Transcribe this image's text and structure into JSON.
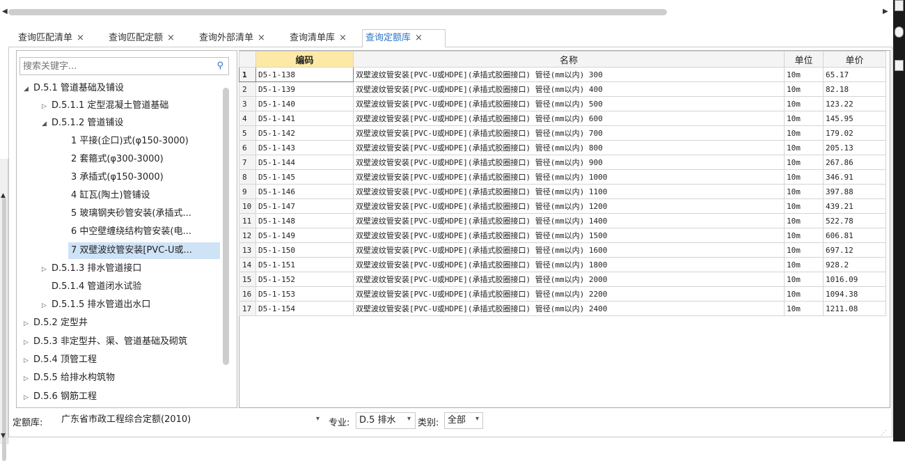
{
  "tabs": [
    {
      "label": "查询匹配清单",
      "close": "×"
    },
    {
      "label": "查询匹配定额",
      "close": "×"
    },
    {
      "label": "查询外部清单",
      "close": "×"
    },
    {
      "label": "查询清单库",
      "close": "×"
    },
    {
      "label": "查询定额库",
      "close": "×",
      "active": true
    }
  ],
  "search": {
    "placeholder": "搜索关键字...",
    "icon": "search-icon"
  },
  "tree": [
    {
      "label": "D.5.1 管道基础及铺设",
      "toggle": "◢"
    },
    {
      "label": "D.5.1.1 定型混凝土管道基础",
      "toggle": "▷"
    },
    {
      "label": "D.5.1.2 管道铺设",
      "toggle": "◢"
    },
    {
      "label": "1 平接(企口)式(φ150-3000)",
      "toggle": ""
    },
    {
      "label": "2 套箍式(φ300-3000)",
      "toggle": ""
    },
    {
      "label": "3 承插式(φ150-3000)",
      "toggle": ""
    },
    {
      "label": "4 缸瓦(陶土)管铺设",
      "toggle": ""
    },
    {
      "label": "5 玻璃钢夹砂管安装(承插式...",
      "toggle": ""
    },
    {
      "label": "6 中空壁缠绕结构管安装(电...",
      "toggle": ""
    },
    {
      "label": "7 双壁波纹管安装[PVC-U或...",
      "toggle": "",
      "selected": true
    },
    {
      "label": "D.5.1.3 排水管道接口",
      "toggle": "▷"
    },
    {
      "label": "D.5.1.4 管道闭水试验",
      "toggle": ""
    },
    {
      "label": "D.5.1.5 排水管道出水口",
      "toggle": "▷"
    },
    {
      "label": "D.5.2 定型井",
      "toggle": "▷"
    },
    {
      "label": "D.5.3 非定型井、渠、管道基础及砌筑",
      "toggle": "▷"
    },
    {
      "label": "D.5.4 顶管工程",
      "toggle": "▷"
    },
    {
      "label": "D.5.5 给排水构筑物",
      "toggle": "▷"
    },
    {
      "label": "D.5.6 钢筋工程",
      "toggle": "▷"
    }
  ],
  "grid": {
    "headers": {
      "code": "编码",
      "name": "名称",
      "unit": "单位",
      "price": "单价"
    },
    "rows": [
      {
        "no": "1",
        "code": "D5-1-138",
        "name": "双壁波纹管安装[PVC-U或HDPE](承插式胶圈接口) 管径(mm以内) 300",
        "unit": "10m",
        "price": "65.17"
      },
      {
        "no": "2",
        "code": "D5-1-139",
        "name": "双壁波纹管安装[PVC-U或HDPE](承插式胶圈接口) 管径(mm以内) 400",
        "unit": "10m",
        "price": "82.18"
      },
      {
        "no": "3",
        "code": "D5-1-140",
        "name": "双壁波纹管安装[PVC-U或HDPE](承插式胶圈接口) 管径(mm以内) 500",
        "unit": "10m",
        "price": "123.22"
      },
      {
        "no": "4",
        "code": "D5-1-141",
        "name": "双壁波纹管安装[PVC-U或HDPE](承插式胶圈接口) 管径(mm以内) 600",
        "unit": "10m",
        "price": "145.95"
      },
      {
        "no": "5",
        "code": "D5-1-142",
        "name": "双壁波纹管安装[PVC-U或HDPE](承插式胶圈接口) 管径(mm以内) 700",
        "unit": "10m",
        "price": "179.02"
      },
      {
        "no": "6",
        "code": "D5-1-143",
        "name": "双壁波纹管安装[PVC-U或HDPE](承插式胶圈接口) 管径(mm以内) 800",
        "unit": "10m",
        "price": "205.13"
      },
      {
        "no": "7",
        "code": "D5-1-144",
        "name": "双壁波纹管安装[PVC-U或HDPE](承插式胶圈接口) 管径(mm以内) 900",
        "unit": "10m",
        "price": "267.86"
      },
      {
        "no": "8",
        "code": "D5-1-145",
        "name": "双壁波纹管安装[PVC-U或HDPE](承插式胶圈接口) 管径(mm以内) 1000",
        "unit": "10m",
        "price": "346.91"
      },
      {
        "no": "9",
        "code": "D5-1-146",
        "name": "双壁波纹管安装[PVC-U或HDPE](承插式胶圈接口) 管径(mm以内) 1100",
        "unit": "10m",
        "price": "397.88"
      },
      {
        "no": "10",
        "code": "D5-1-147",
        "name": "双壁波纹管安装[PVC-U或HDPE](承插式胶圈接口) 管径(mm以内) 1200",
        "unit": "10m",
        "price": "439.21"
      },
      {
        "no": "11",
        "code": "D5-1-148",
        "name": "双壁波纹管安装[PVC-U或HDPE](承插式胶圈接口) 管径(mm以内) 1400",
        "unit": "10m",
        "price": "522.78"
      },
      {
        "no": "12",
        "code": "D5-1-149",
        "name": "双壁波纹管安装[PVC-U或HDPE](承插式胶圈接口) 管径(mm以内) 1500",
        "unit": "10m",
        "price": "606.81"
      },
      {
        "no": "13",
        "code": "D5-1-150",
        "name": "双壁波纹管安装[PVC-U或HDPE](承插式胶圈接口) 管径(mm以内) 1600",
        "unit": "10m",
        "price": "697.12"
      },
      {
        "no": "14",
        "code": "D5-1-151",
        "name": "双壁波纹管安装[PVC-U或HDPE](承插式胶圈接口) 管径(mm以内) 1800",
        "unit": "10m",
        "price": "928.2"
      },
      {
        "no": "15",
        "code": "D5-1-152",
        "name": "双壁波纹管安装[PVC-U或HDPE](承插式胶圈接口) 管径(mm以内) 2000",
        "unit": "10m",
        "price": "1016.09"
      },
      {
        "no": "16",
        "code": "D5-1-153",
        "name": "双壁波纹管安装[PVC-U或HDPE](承插式胶圈接口) 管径(mm以内) 2200",
        "unit": "10m",
        "price": "1094.38"
      },
      {
        "no": "17",
        "code": "D5-1-154",
        "name": "双壁波纹管安装[PVC-U或HDPE](承插式胶圈接口) 管径(mm以内) 2400",
        "unit": "10m",
        "price": "1211.08"
      }
    ]
  },
  "bottom": {
    "library_label": "定额库:",
    "library_value": "广东省市政工程综合定额(2010)",
    "major_label": "专业:",
    "major_value": "D.5 排水",
    "category_label": "类别:",
    "category_value": "全部"
  },
  "colors": {
    "accent": "#2b74c6",
    "selected_row": "#cfe3f7",
    "code_header": "#fde9a6"
  }
}
